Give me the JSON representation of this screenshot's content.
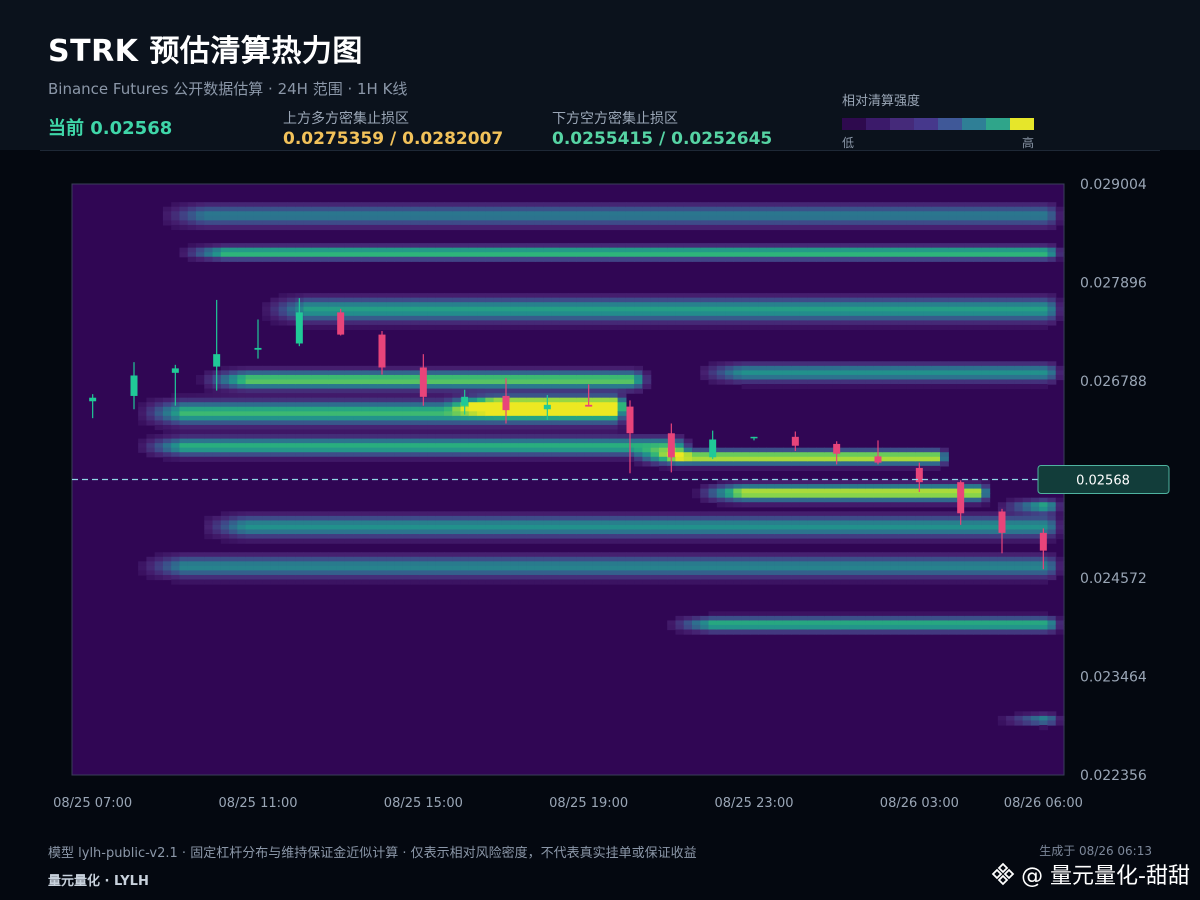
{
  "header": {
    "title": "STRK 预估清算热力图",
    "subtitle": "Binance Futures 公开数据估算 · 24H 范围 · 1H K线",
    "current_label": "当前 0.02568",
    "upper_zone": {
      "label": "上方多方密集止损区",
      "value": "0.0275359 / 0.0282007"
    },
    "lower_zone": {
      "label": "下方空方密集止损区",
      "value": "0.0255415 / 0.0252645"
    },
    "legend": {
      "label": "相对清算强度",
      "low": "低",
      "high": "高",
      "colors": [
        "#2e0a4e",
        "#3b1a6a",
        "#452a7a",
        "#46388c",
        "#3f5898",
        "#2f7f96",
        "#2fa58a",
        "#e6e62a"
      ]
    }
  },
  "chart_data": {
    "type": "heatmap",
    "y_ticks": [
      "0.029004",
      "0.027896",
      "0.026788",
      "0.024572",
      "0.023464",
      "0.022356"
    ],
    "ylim": [
      0.022356,
      0.029004
    ],
    "x_ticks": [
      "08/25 07:00",
      "08/25 11:00",
      "08/25 15:00",
      "08/25 19:00",
      "08/25 23:00",
      "08/26 03:00",
      "08/26 06:00"
    ],
    "current_price": 0.02568,
    "current_price_label": "0.02568",
    "candle_colors": {
      "up": "#20c997",
      "down": "#e8447a"
    },
    "candles": [
      {
        "t": "08/25 07:00",
        "o": 0.02656,
        "h": 0.02664,
        "l": 0.02637,
        "c": 0.0266
      },
      {
        "t": "08/25 08:00",
        "o": 0.02662,
        "h": 0.027,
        "l": 0.02647,
        "c": 0.02685
      },
      {
        "t": "08/25 09:00",
        "o": 0.02688,
        "h": 0.02697,
        "l": 0.02651,
        "c": 0.02693
      },
      {
        "t": "08/25 10:00",
        "o": 0.02695,
        "h": 0.0277,
        "l": 0.02668,
        "c": 0.02709
      },
      {
        "t": "08/25 11:00",
        "o": 0.02714,
        "h": 0.02748,
        "l": 0.02704,
        "c": 0.02716
      },
      {
        "t": "08/25 12:00",
        "o": 0.02721,
        "h": 0.02772,
        "l": 0.02718,
        "c": 0.02756
      },
      {
        "t": "08/25 13:00",
        "o": 0.02756,
        "h": 0.0276,
        "l": 0.0273,
        "c": 0.02731
      },
      {
        "t": "08/25 14:00",
        "o": 0.02731,
        "h": 0.02735,
        "l": 0.02686,
        "c": 0.02694
      },
      {
        "t": "08/25 15:00",
        "o": 0.02694,
        "h": 0.02709,
        "l": 0.02651,
        "c": 0.02661
      },
      {
        "t": "08/25 16:00",
        "o": 0.02651,
        "h": 0.02669,
        "l": 0.02641,
        "c": 0.02661
      },
      {
        "t": "08/25 17:00",
        "o": 0.02662,
        "h": 0.02682,
        "l": 0.02631,
        "c": 0.02646
      },
      {
        "t": "08/25 18:00",
        "o": 0.02647,
        "h": 0.02663,
        "l": 0.02635,
        "c": 0.02652
      },
      {
        "t": "08/25 19:00",
        "o": 0.02652,
        "h": 0.02675,
        "l": 0.0265,
        "c": 0.0265
      },
      {
        "t": "08/25 20:00",
        "o": 0.0265,
        "h": 0.02657,
        "l": 0.02575,
        "c": 0.0262
      },
      {
        "t": "08/25 21:00",
        "o": 0.0262,
        "h": 0.02631,
        "l": 0.02576,
        "c": 0.02593
      },
      {
        "t": "08/25 22:00",
        "o": 0.02593,
        "h": 0.02623,
        "l": 0.02591,
        "c": 0.02613
      },
      {
        "t": "08/25 23:00",
        "o": 0.02615,
        "h": 0.02616,
        "l": 0.02612,
        "c": 0.02616
      },
      {
        "t": "08/26 00:00",
        "o": 0.02616,
        "h": 0.02622,
        "l": 0.026,
        "c": 0.02606
      },
      {
        "t": "08/26 01:00",
        "o": 0.02608,
        "h": 0.02611,
        "l": 0.02585,
        "c": 0.02597
      },
      {
        "t": "08/26 02:00",
        "o": 0.02594,
        "h": 0.02612,
        "l": 0.02585,
        "c": 0.02587
      },
      {
        "t": "08/26 03:00",
        "o": 0.02581,
        "h": 0.02587,
        "l": 0.02554,
        "c": 0.02565
      },
      {
        "t": "08/26 04:00",
        "o": 0.02565,
        "h": 0.02567,
        "l": 0.02517,
        "c": 0.0253
      },
      {
        "t": "08/26 05:00",
        "o": 0.02532,
        "h": 0.02535,
        "l": 0.02485,
        "c": 0.02508
      },
      {
        "t": "08/26 06:00",
        "o": 0.02508,
        "h": 0.02513,
        "l": 0.02467,
        "c": 0.02488
      }
    ],
    "bands": [
      {
        "price": 0.02865,
        "intensity": 0.5,
        "t0": 2,
        "t1": 24,
        "w": 0.00012
      },
      {
        "price": 0.02823,
        "intensity": 0.78,
        "t0": 2.5,
        "t1": 24,
        "w": 7e-05
      },
      {
        "price": 0.02759,
        "intensity": 0.65,
        "t0": 4.5,
        "t1": 24,
        "w": 0.00013
      },
      {
        "price": 0.02688,
        "intensity": 0.6,
        "t0": 15,
        "t1": 24,
        "w": 0.0001
      },
      {
        "price": 0.0268,
        "intensity": 0.82,
        "t0": 3,
        "t1": 14,
        "w": 0.0001
      },
      {
        "price": 0.02652,
        "intensity": 0.95,
        "t0": 9,
        "t1": 13.5,
        "w": 9e-05
      },
      {
        "price": 0.02643,
        "intensity": 0.75,
        "t0": 1.5,
        "t1": 13.5,
        "w": 0.00013
      },
      {
        "price": 0.02605,
        "intensity": 0.72,
        "t0": 1.5,
        "t1": 15,
        "w": 0.0001
      },
      {
        "price": 0.02593,
        "intensity": 0.95,
        "t0": 13.5,
        "t1": 21.3,
        "w": 8e-05
      },
      {
        "price": 0.02553,
        "intensity": 0.95,
        "t0": 15,
        "t1": 22.3,
        "w": 9e-05
      },
      {
        "price": 0.02538,
        "intensity": 0.7,
        "t0": 22.3,
        "t1": 24,
        "w": 7e-05
      },
      {
        "price": 0.02515,
        "intensity": 0.6,
        "t0": 3,
        "t1": 24,
        "w": 0.00012
      },
      {
        "price": 0.0247,
        "intensity": 0.55,
        "t0": 1.5,
        "t1": 24,
        "w": 0.00012
      },
      {
        "price": 0.02405,
        "intensity": 0.72,
        "t0": 14.3,
        "t1": 24,
        "w": 8e-05
      },
      {
        "price": 0.02298,
        "intensity": 0.55,
        "t0": 22.3,
        "t1": 24,
        "w": 6e-05
      }
    ]
  },
  "footer": {
    "note": "模型 lylh-public-v2.1 · 固定杠杆分布与维持保证金近似计算 · 仅表示相对风险密度，不代表真实挂单或保证收益",
    "brand": "量元量化 · LYLH",
    "generated": "生成于 08/26 06:13",
    "watermark": "@ 量元量化-甜甜"
  }
}
